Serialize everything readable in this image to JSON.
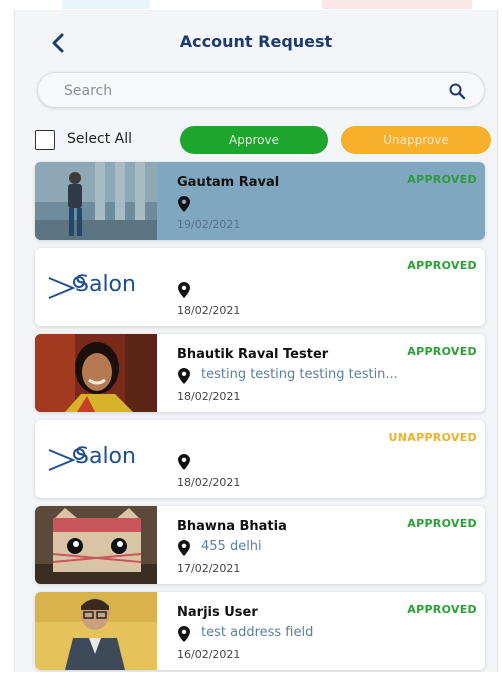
{
  "header": {
    "title": "Account Request"
  },
  "search": {
    "placeholder": "Search"
  },
  "actions": {
    "select_all": "Select All",
    "approve": "Approve",
    "unapprove": "Unapprove"
  },
  "requests": [
    {
      "name": "Gautam Raval",
      "status": "APPROVED",
      "address": "",
      "date": "19/02/2021"
    },
    {
      "name": "",
      "status": "APPROVED",
      "address": "",
      "date": "18/02/2021",
      "logo_text": "Salon"
    },
    {
      "name": "Bhautik Raval Tester",
      "status": "APPROVED",
      "address": "testing testing testing testin...",
      "date": "18/02/2021"
    },
    {
      "name": "",
      "status": "UNAPPROVED",
      "address": "",
      "date": "18/02/2021",
      "logo_text": "Salon"
    },
    {
      "name": "Bhawna Bhatia",
      "status": "APPROVED",
      "address": "455 delhi",
      "date": "17/02/2021"
    },
    {
      "name": "Narjis User",
      "status": "APPROVED",
      "address": "test address field",
      "date": "16/02/2021"
    }
  ],
  "colors": {
    "approved": "#2aa037",
    "unapproved": "#e9b22a",
    "approve_button": "#1ea52d",
    "unapprove_button": "#f6b02c",
    "selected_card": "#7fa7bf",
    "title": "#1f3b6e"
  }
}
